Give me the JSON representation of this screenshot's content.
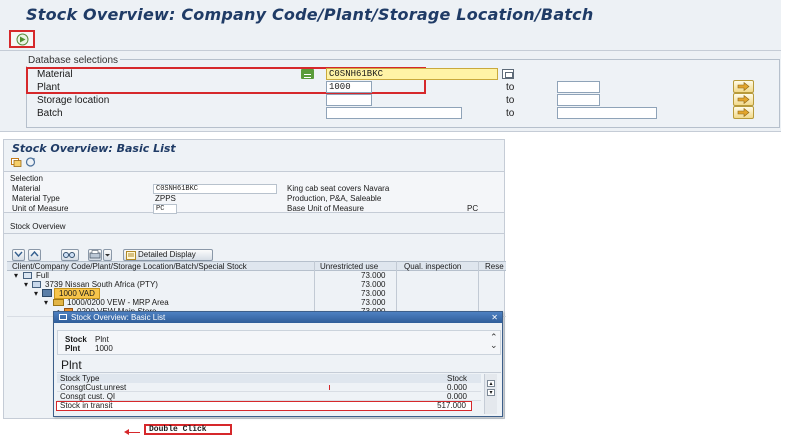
{
  "top": {
    "title": "Stock Overview: Company Code/Plant/Storage Location/Batch",
    "section": "Database selections",
    "fields": [
      {
        "label": "Material",
        "value": "C0SNH61BKC"
      },
      {
        "label": "Plant",
        "value": "1000",
        "to_label": "to"
      },
      {
        "label": "Storage location",
        "value": "",
        "to_label": "to"
      },
      {
        "label": "Batch",
        "value": "",
        "to_label": "to"
      }
    ]
  },
  "basic": {
    "title": "Stock Overview: Basic List",
    "selection_header": "Selection",
    "rows": [
      {
        "label": "Material",
        "value": "C0SNH61BKC",
        "desc": "King cab seat covers Navara",
        "extra": ""
      },
      {
        "label": "Material Type",
        "value": "ZPPS",
        "desc": "Production, P&A, Saleable",
        "extra": ""
      },
      {
        "label": "Unit of Measure",
        "value": "PC",
        "desc": "Base Unit of Measure",
        "extra": "PC"
      }
    ],
    "stock_overview_header": "Stock Overview",
    "detailed_display_label": "Detailed Display",
    "columns": [
      "Client/Company Code/Plant/Storage Location/Batch/Special Stock",
      "Unrestricted use",
      "Qual. inspection",
      "Rese"
    ],
    "tree": [
      {
        "label": "Full",
        "unrestricted": "73.000"
      },
      {
        "label": "3739 Nissan South Africa (PTY)",
        "unrestricted": "73.000"
      },
      {
        "label": "1000 VAD",
        "unrestricted": "73.000"
      },
      {
        "label": "1000/0200 VEW - MRP Area",
        "unrestricted": "73.000"
      },
      {
        "label": "0200 VEW-Main Store",
        "unrestricted": "73.000"
      }
    ],
    "callout": "Double Click"
  },
  "popup": {
    "title": "Stock Overview: Basic List",
    "close": "✕",
    "stock_label": "Stock",
    "stock_value": "Plnt",
    "plnt_label": "Plnt",
    "plnt_value": "1000",
    "heading": "Plnt",
    "col_type": "Stock Type",
    "col_stock": "Stock",
    "rows": [
      {
        "type": "ConsgtCust.unrest",
        "stock": "0.000"
      },
      {
        "type": "Consgt cust. QI",
        "stock": "0.000"
      },
      {
        "type": "Stock in transit",
        "stock": "517.000"
      }
    ]
  },
  "colors": {
    "title_blue": "#1f3b66",
    "highlight_red": "#d6282b",
    "material_yellow": "#fff3a6",
    "panel_gray": "#e7ebf0",
    "popup_header": "#3e6fb0"
  }
}
